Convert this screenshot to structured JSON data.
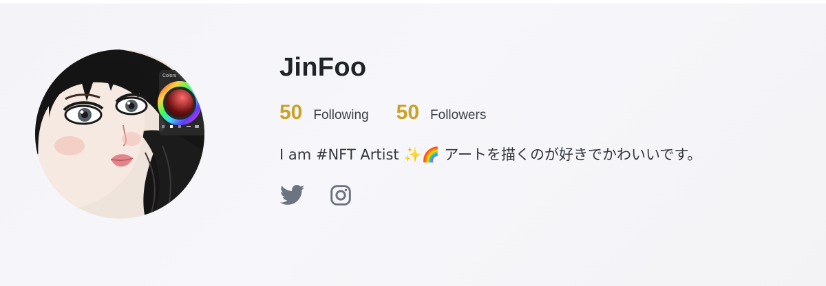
{
  "profile": {
    "username": "JinFoo",
    "following_count": "50",
    "following_label": "Following",
    "followers_count": "50",
    "followers_label": "Followers",
    "bio": "I am #NFT Artist ✨🌈 アートを描くのが好きでかわいいです。"
  },
  "avatar": {
    "palette_title": "Colors"
  },
  "socials": [
    {
      "icon": "twitter-icon"
    },
    {
      "icon": "instagram-icon"
    }
  ],
  "colors": {
    "accent": "#c9a227",
    "icon_gray": "#6b7480",
    "text": "#1f2328"
  }
}
